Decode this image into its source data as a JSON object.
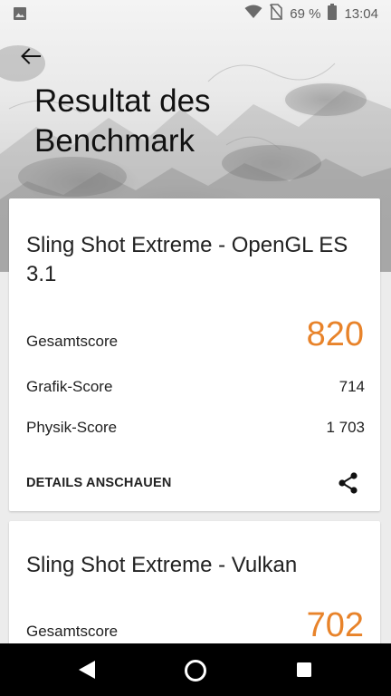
{
  "status_bar": {
    "battery_percent": "69 %",
    "time": "13:04",
    "icons": [
      "image-icon",
      "wifi-icon",
      "no-sim-icon",
      "battery-icon"
    ]
  },
  "header": {
    "title": "Resultat des Benchmark"
  },
  "cards": [
    {
      "title": "Sling Shot Extreme - OpenGL ES 3.1",
      "overall_label": "Gesamtscore",
      "overall_score": "820",
      "graphics_label": "Grafik-Score",
      "graphics_score": "714",
      "physics_label": "Physik-Score",
      "physics_score": "1 703",
      "details_label": "DETAILS ANSCHAUEN"
    },
    {
      "title": "Sling Shot Extreme - Vulkan",
      "overall_label": "Gesamtscore",
      "overall_score": "702"
    }
  ],
  "colors": {
    "score_accent": "#e8832a",
    "navbar": "#000000",
    "text_primary": "#222222"
  },
  "nav_bar": {
    "icons": [
      "back-triangle-icon",
      "home-circle-icon",
      "recents-square-icon"
    ]
  }
}
